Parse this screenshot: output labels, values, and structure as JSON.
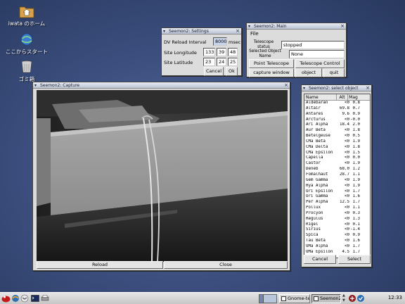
{
  "desktop": {
    "icons": [
      {
        "label": "iwata のホーム",
        "icon": "home-folder-icon"
      },
      {
        "label": "ここからスタート",
        "icon": "start-here-icon"
      },
      {
        "label": "ゴミ箱",
        "icon": "trash-icon"
      }
    ]
  },
  "settings": {
    "title": "Seemon2: Settings",
    "dv_reload_label": "DV Reload Interval",
    "dv_reload_value": "8000",
    "dv_reload_unit": "msec",
    "longitude_label": "Site Longitude",
    "longitude": [
      "133",
      "39",
      "48"
    ],
    "latitude_label": "Site Latitude",
    "latitude": [
      "23",
      "24",
      "25"
    ],
    "cancel": "Cancel",
    "ok": "Ok"
  },
  "main": {
    "title": "Seemon2: Main",
    "menu_file": "File",
    "telescope_status_label": "Telescope status",
    "telescope_status_value": "stopped",
    "selected_object_label": "Selected Object Name",
    "selected_object_value": "None",
    "point_telescope": "Point Telescope",
    "telescope_control": "Telescope Control",
    "capture_window": "capture window",
    "object": "object",
    "quit": "quit"
  },
  "capture": {
    "title": "Seemon2: Capture",
    "reload": "Reload",
    "close": "Close"
  },
  "select": {
    "title": "Seemon2: select object",
    "headers": [
      "Name",
      "Alt",
      "Mag"
    ],
    "rows": [
      [
        "Aldebaran",
        "<0",
        "0.8"
      ],
      [
        "Altair",
        "69.8",
        "0.7"
      ],
      [
        "Antares",
        "9.6",
        "0.9"
      ],
      [
        "Arcturus",
        "<0",
        "-0.0"
      ],
      [
        "Ari Alpha",
        "18.4",
        "2.0"
      ],
      [
        "Aur Beta",
        "<0",
        "1.8"
      ],
      [
        "Betelgeuse",
        "<0",
        "0.5"
      ],
      [
        "CMa Beta",
        "<0",
        "1.9"
      ],
      [
        "CMa Delta",
        "<0",
        "1.8"
      ],
      [
        "CMa Epsilon",
        "<0",
        "1.5"
      ],
      [
        "Capella",
        "<0",
        "0.0"
      ],
      [
        "Castor",
        "<0",
        "1.9"
      ],
      [
        "Deneb",
        "68.0",
        "1.2"
      ],
      [
        "Fomalhaut",
        "28.7",
        "1.1"
      ],
      [
        "Gem Gamma",
        "<0",
        "1.9"
      ],
      [
        "Hya Alpha",
        "<0",
        "1.9"
      ],
      [
        "Ori Epsilon",
        "<0",
        "1.7"
      ],
      [
        "Ori Gamma",
        "<0",
        "1.6"
      ],
      [
        "Per Alpha",
        "12.5",
        "1.7"
      ],
      [
        "Pollux",
        "<0",
        "1.1"
      ],
      [
        "Procyon",
        "<0",
        "0.3"
      ],
      [
        "Regulus",
        "<0",
        "1.3"
      ],
      [
        "Rigel",
        "<0",
        "0.1"
      ],
      [
        "Sirius",
        "<0",
        "-1.4"
      ],
      [
        "Spica",
        "<0",
        "0.9"
      ],
      [
        "Tau Beta",
        "<0",
        "1.6"
      ],
      [
        "UMa Alpha",
        "<0",
        "1.7"
      ],
      [
        "UMa Epsilon",
        "4.5",
        "1.7"
      ],
      [
        "UMa Eta",
        "7.9",
        "1.8"
      ],
      [
        "Vega",
        "57.8",
        "0.0"
      ]
    ],
    "cancel": "Cancel",
    "select": "Select"
  },
  "taskbar": {
    "tasks": [
      "Gnome-terr",
      "Seemon2 C"
    ],
    "clock": "12:33"
  },
  "colors": {
    "accent": "#9cb4d8",
    "desktop": "#3d5080",
    "panel": "#d0d0d0"
  }
}
